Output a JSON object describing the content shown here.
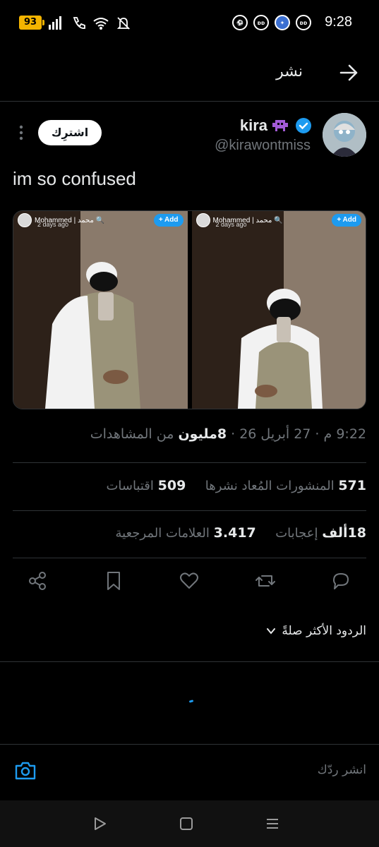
{
  "status_bar": {
    "battery": "93",
    "time": "9:28",
    "app_icons": [
      "ball-icon",
      "app-icon",
      "shield-app-icon",
      "app-icon"
    ]
  },
  "nav": {
    "title": "نشر"
  },
  "author": {
    "display_name": "kira",
    "handle": "@kirawontmiss",
    "subscribe_label": "اشترِك"
  },
  "tweet": {
    "text": "im so confused"
  },
  "media": [
    {
      "name": "Mohammed | محمد 🔍",
      "time": "2 days ago",
      "add_label": "+ Add"
    },
    {
      "name": "Mohammed | محمد 🔍",
      "time": "2 days ago",
      "add_label": "+ Add"
    }
  ],
  "meta": {
    "time": "9:22 م",
    "date": "27 أبريل 26",
    "views_number": "8مليون",
    "views_label": "من المشاهدات"
  },
  "stats": {
    "reposts_count": "571",
    "reposts_label": "المنشورات المُعاد نشرها",
    "quotes_count": "509",
    "quotes_label": "اقتباسات",
    "likes_count": "18ألف",
    "likes_label": "إعجابات",
    "bookmarks_count": "3.417",
    "bookmarks_label": "العلامات المرجعية"
  },
  "replies": {
    "sort_label": "الردود الأكثر صلةً"
  },
  "reply_bar": {
    "placeholder": "انشر ردّك"
  },
  "colors": {
    "accent": "#1d9bf0",
    "background": "#000000",
    "muted": "#71767b",
    "text": "#e7e9ea"
  }
}
